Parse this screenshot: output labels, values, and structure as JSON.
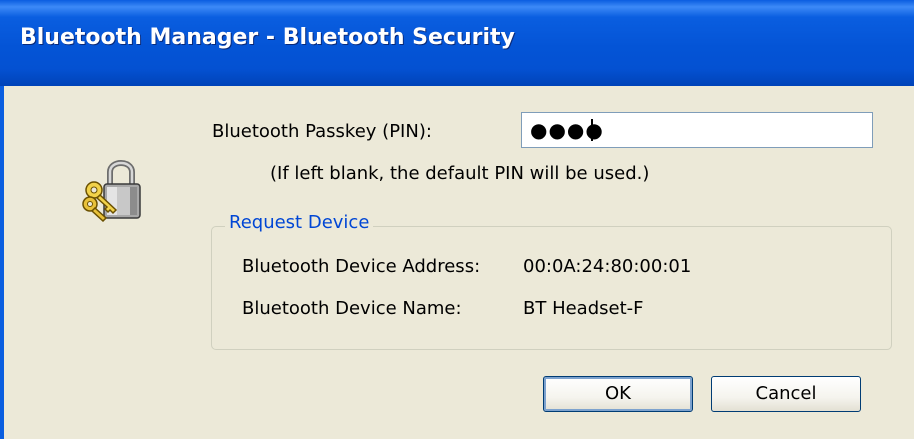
{
  "window": {
    "title": "Bluetooth Manager - Bluetooth Security"
  },
  "icon": {
    "name": "lock-with-keys-icon"
  },
  "pin": {
    "label": "Bluetooth Passkey (PIN):",
    "masked_value": "●●●●",
    "hint": "(If left blank, the default PIN will be used.)"
  },
  "request_device": {
    "group_title": "Request Device",
    "address_label": "Bluetooth Device Address:",
    "address_value": "00:0A:24:80:00:01",
    "name_label": "Bluetooth Device Name:",
    "name_value": "BT Headset-F"
  },
  "buttons": {
    "ok_label": "OK",
    "cancel_label": "Cancel"
  },
  "colors": {
    "titlebar": "#0454d6",
    "dialog_bg": "#ece9d8",
    "group_title": "#0046d5"
  }
}
